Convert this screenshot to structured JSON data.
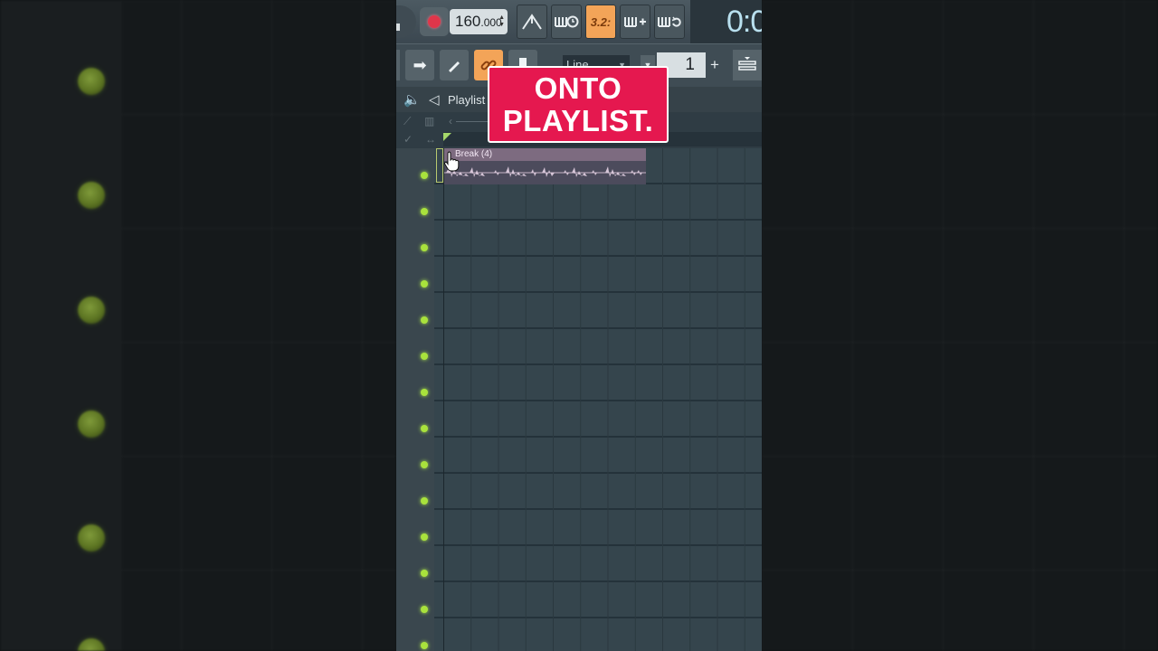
{
  "toolbar": {
    "tempo_int": "160",
    "tempo_frac": ".000",
    "pattern_mode_label": "3.2:",
    "time_display": "0:0"
  },
  "toolbar2": {
    "snap_label": "Line",
    "step_value": "1",
    "plus_label": "+"
  },
  "playlist": {
    "title": "Playlist"
  },
  "clip": {
    "name": "Break (4)"
  },
  "overlay": {
    "line1": "ONTO",
    "line2": "PLAYLIST."
  },
  "colors": {
    "accent_orange": "#f3a458",
    "record_red": "#e0364a",
    "led_green": "#a9e23c",
    "banner_pink": "#e5184f",
    "clip_purple": "#7d6b80"
  }
}
